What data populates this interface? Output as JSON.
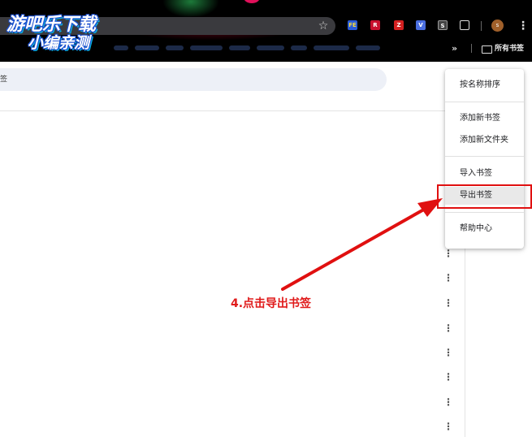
{
  "logo": {
    "line1": "游吧乐下载",
    "line2": "小编亲测"
  },
  "toolbar": {
    "star_glyph": "☆",
    "ext_icons": [
      "FE",
      "R",
      "Z",
      "V",
      "S"
    ],
    "avatar_letter": "s",
    "menu_glyph": "⋮"
  },
  "bookmarks_bar": {
    "chevron": "»",
    "all_bookmarks_label": "所有书签"
  },
  "search": {
    "partial_text": "签"
  },
  "row_menu_glyph": "⋮",
  "menu": {
    "sort_by_name": "按名称排序",
    "add_bookmark": "添加新书签",
    "add_folder": "添加新文件夹",
    "import_bookmarks": "导入书签",
    "export_bookmarks": "导出书签",
    "help_center": "帮助中心"
  },
  "annotation": {
    "step_text": "4.点击导出书签",
    "color": "#e01010"
  },
  "colors": {
    "chrome_bg": "#000000",
    "search_bg": "#edf0f7",
    "menu_highlight": "#e9e9e9"
  }
}
